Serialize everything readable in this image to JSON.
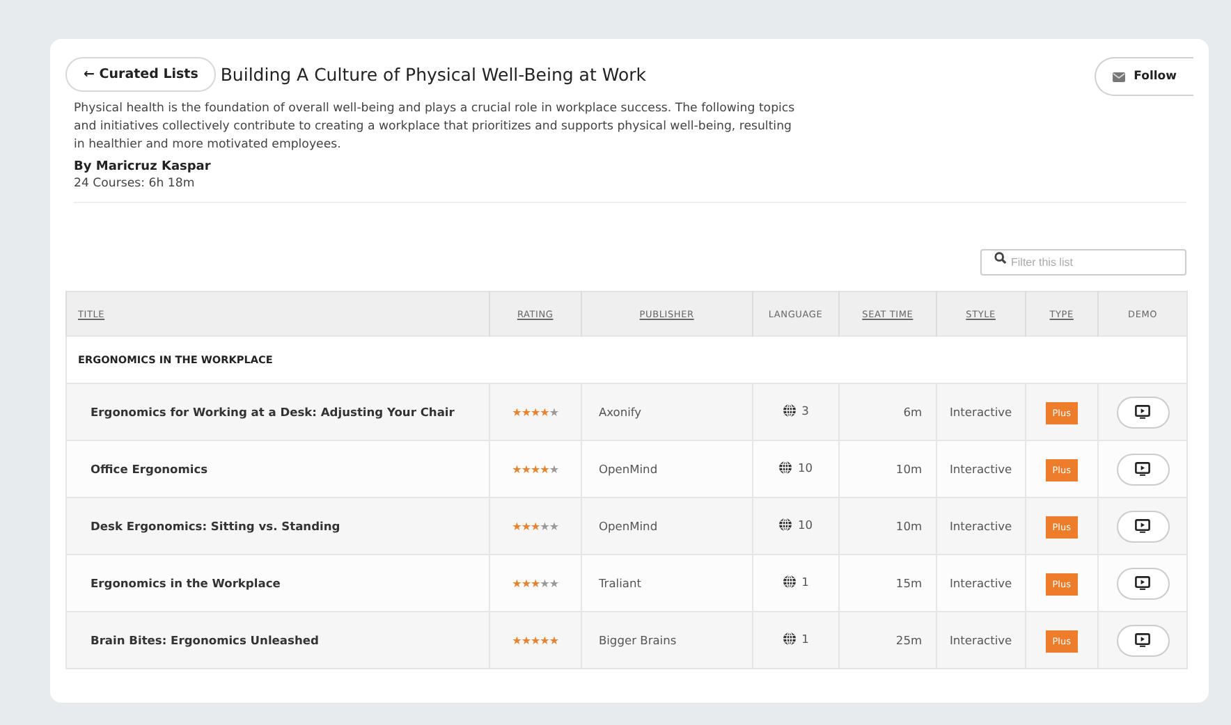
{
  "back_button": {
    "label": "Curated Lists",
    "icon": "←"
  },
  "title": "Building A Culture of Physical Well-Being at Work",
  "follow_button": {
    "label": "Follow"
  },
  "description": "Physical health is the foundation of overall well-being and plays a crucial role in workplace success. The following topics and initiatives collectively contribute to creating a workplace that prioritizes and supports physical well-being, resulting in healthier and more motivated employees.",
  "author": "By Maricruz Kaspar",
  "summary": "24 Courses: 6h 18m",
  "filter": {
    "placeholder": "Filter this list"
  },
  "table": {
    "columns": [
      {
        "label": "TITLE",
        "sortable": true
      },
      {
        "label": "RATING",
        "sortable": true
      },
      {
        "label": "PUBLISHER",
        "sortable": true
      },
      {
        "label": "LANGUAGE",
        "sortable": false
      },
      {
        "label": "SEAT TIME",
        "sortable": true
      },
      {
        "label": "STYLE",
        "sortable": true
      },
      {
        "label": "TYPE",
        "sortable": true
      },
      {
        "label": "DEMO",
        "sortable": false
      }
    ],
    "group": "ERGONOMICS IN THE WORKPLACE",
    "rows": [
      {
        "title": "Ergonomics for Working at a Desk: Adjusting Your Chair",
        "stars": 4,
        "publisher": "Axonify",
        "language": "3",
        "seat_time": "6m",
        "style": "Interactive",
        "type": "Plus"
      },
      {
        "title": "Office Ergonomics",
        "stars": 4,
        "publisher": "OpenMind",
        "language": "10",
        "seat_time": "10m",
        "style": "Interactive",
        "type": "Plus"
      },
      {
        "title": "Desk Ergonomics: Sitting vs. Standing",
        "stars": 3,
        "publisher": "OpenMind",
        "language": "10",
        "seat_time": "10m",
        "style": "Interactive",
        "type": "Plus"
      },
      {
        "title": "Ergonomics in the Workplace",
        "stars": 3,
        "publisher": "Traliant",
        "language": "1",
        "seat_time": "15m",
        "style": "Interactive",
        "type": "Plus"
      },
      {
        "title": "Brain Bites: Ergonomics Unleashed",
        "stars": 5,
        "publisher": "Bigger Brains",
        "language": "1",
        "seat_time": "25m",
        "style": "Interactive",
        "type": "Plus"
      }
    ]
  }
}
